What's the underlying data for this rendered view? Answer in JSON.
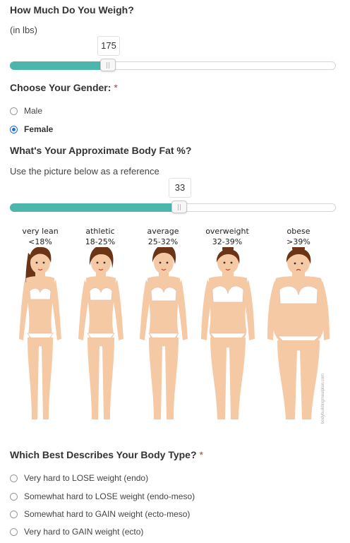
{
  "weight": {
    "title": "How Much Do You Weigh?",
    "unit_note": "(in lbs)",
    "value": "175",
    "fill_fraction": 0.3
  },
  "gender": {
    "title": "Choose Your Gender:",
    "required_mark": "*",
    "options": [
      {
        "label": "Male",
        "selected": false
      },
      {
        "label": "Female",
        "selected": true
      }
    ]
  },
  "bodyfat": {
    "title": "What's Your Approximate Body Fat %?",
    "hint": "Use the picture below as a reference",
    "value": "33",
    "fill_fraction": 0.52,
    "categories": [
      {
        "name": "very lean",
        "range": "<18%"
      },
      {
        "name": "athletic",
        "range": "18-25%"
      },
      {
        "name": "average",
        "range": "25-32%"
      },
      {
        "name": "overweight",
        "range": "32-39%"
      },
      {
        "name": "obese",
        "range": ">39%"
      }
    ],
    "watermark": "bodybuildingmealplan.com"
  },
  "bodytype": {
    "title": "Which Best Describes Your Body Type?",
    "required_mark": "*",
    "options": [
      {
        "label": "Very hard to LOSE weight (endo)",
        "selected": false
      },
      {
        "label": "Somewhat hard to LOSE weight (endo-meso)",
        "selected": false
      },
      {
        "label": "Somewhat hard to GAIN weight (ecto-meso)",
        "selected": false
      },
      {
        "label": "Very hard to GAIN weight (ecto)",
        "selected": false
      }
    ]
  },
  "colors": {
    "accent": "#4db6ac",
    "radio_selected": "#1e6fd9",
    "required": "#c0392b",
    "skin": "#f6c9a5",
    "hair": "#6b3416"
  }
}
